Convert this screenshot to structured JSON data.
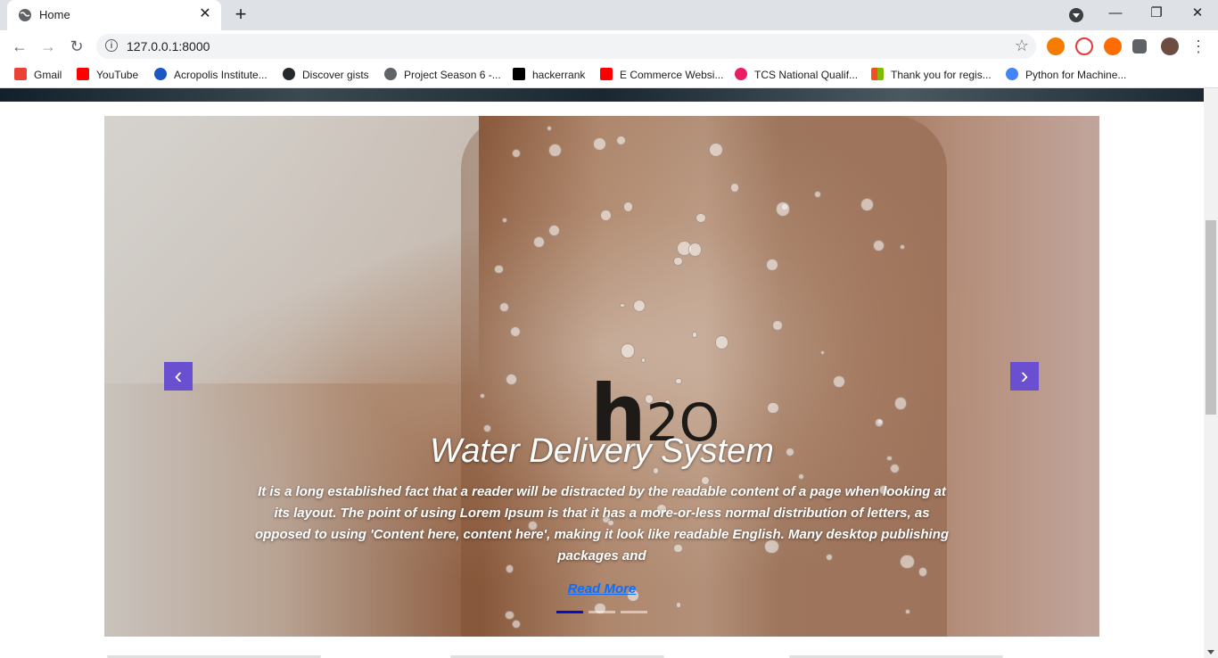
{
  "browser": {
    "tab": {
      "title": "Home",
      "close": "✕"
    },
    "new_tab": "+",
    "nav": {
      "back": "←",
      "forward": "→",
      "reload": "↻"
    },
    "address": {
      "url": "127.0.0.1:8000",
      "info": "i",
      "star": "☆"
    },
    "window": {
      "minimize": "—",
      "restore": "❐",
      "close": "✕",
      "menu": "⋮"
    },
    "bookmarks": [
      {
        "label": "Gmail",
        "color": "#ea4335"
      },
      {
        "label": "YouTube",
        "color": "#ff0000"
      },
      {
        "label": "Acropolis Institute...",
        "color": "#1a57c4"
      },
      {
        "label": "Discover gists",
        "color": "#24292e"
      },
      {
        "label": "Project Season 6 -...",
        "color": "#5f6368"
      },
      {
        "label": "hackerrank",
        "color": "#000000"
      },
      {
        "label": "E Commerce Websi...",
        "color": "#ff0000"
      },
      {
        "label": "TCS National Qualif...",
        "color": "#e91e63"
      },
      {
        "label": "Thank you for regis...",
        "color": "#f25022"
      },
      {
        "label": "Python for Machine...",
        "color": "#4285f4"
      }
    ]
  },
  "carousel": {
    "title": "Water Delivery System",
    "text": "It is a long established fact that a reader will be distracted by the readable content of a page when looking at its layout. The point of using Lorem Ipsum is that it has a more-or-less normal distribution of letters, as opposed to using 'Content here, content here', making it look like readable English. Many desktop publishing packages and",
    "link": "Read More",
    "prev": "‹",
    "next": "›",
    "slides": 3,
    "active_slide": 1,
    "accent_color": "#6a4fd1"
  }
}
